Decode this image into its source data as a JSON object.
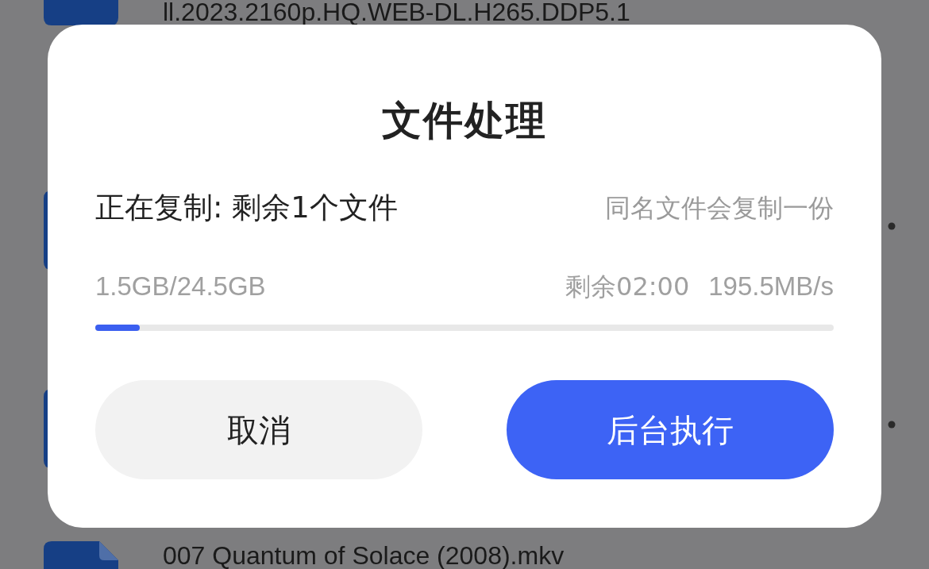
{
  "file_list": [
    {
      "name": "ll.2023.2160p.HQ.WEB-DL.H265.DDP5.1"
    },
    {
      "name": "007 Quantum of Solace (2008).mkv"
    }
  ],
  "dialog": {
    "title": "文件处理",
    "status": "正在复制: 剩余1个文件",
    "note": "同名文件会复制一份",
    "transferred": "1.5GB/24.5GB",
    "remaining": "剩余02:00",
    "speed": "195.5MB/s",
    "progress": {
      "level": 0.06
    },
    "buttons": [
      {
        "label": "取消",
        "kind": "secondary"
      },
      {
        "label": "后台执行",
        "kind": "primary"
      }
    ]
  }
}
